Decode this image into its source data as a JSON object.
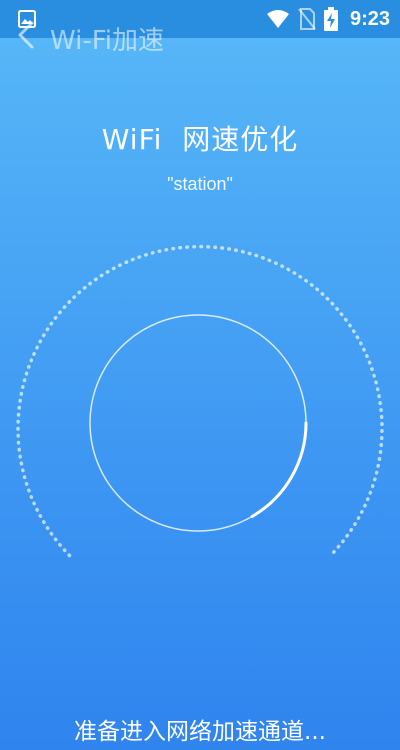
{
  "app": {
    "nav_title": "Wi-Fi加速",
    "heading_brand": "WiFi",
    "heading_text": "网速优化",
    "ssid": "\"station\"",
    "status_message": "准备进入网络加速通道..."
  },
  "status_bar": {
    "time": "9:23",
    "icons": [
      "gallery-icon",
      "wifi-icon",
      "no-sim-icon",
      "battery-charging-icon"
    ]
  },
  "colors": {
    "background_top": "#58b9f8",
    "background_bottom": "#2f84ee",
    "status_bar": "#2a8ee0",
    "foreground": "#ffffff"
  }
}
